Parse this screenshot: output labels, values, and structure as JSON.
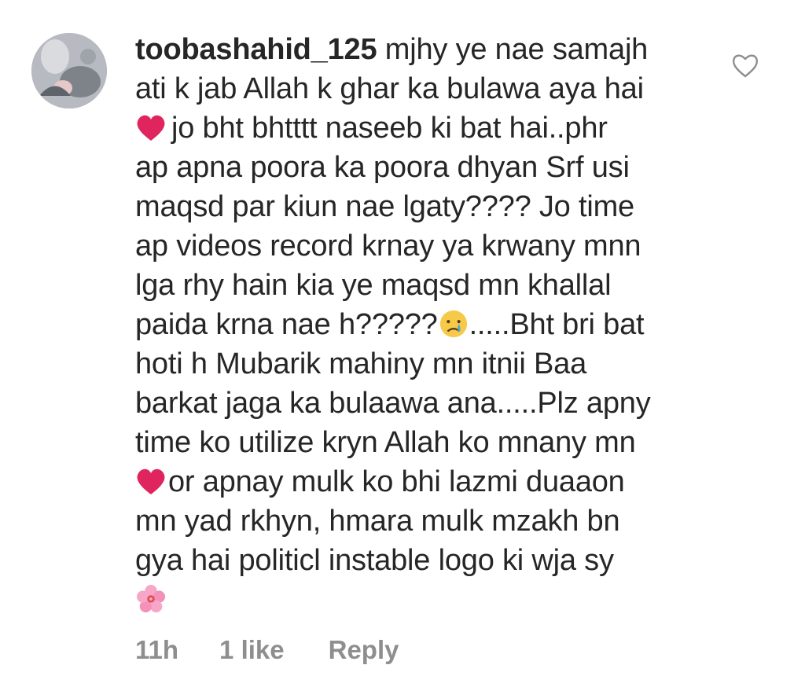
{
  "comment": {
    "username": "toobashahid_125",
    "lines": [
      "mjhy ye nae samajh",
      "ati k jab Allah k ghar ka bulawa aya hai",
      "jo bht bhtttt naseeb ki bat hai..phr",
      "ap apna poora ka poora dhyan Srf usi",
      "maqsd par kiun nae lgaty???? Jo time",
      "ap videos record krnay ya krwany mnn",
      "lga rhy hain kia ye maqsd mn khallal",
      "paida krna nae h?????",
      ".....Bht bri bat",
      "hoti h Mubarik mahiny mn itnii Baa",
      "barkat jaga ka bulaawa ana.....Plz apny",
      "time ko utilize kryn Allah ko mnany mn",
      "or apnay mulk ko bhi  lazmi duaaon",
      "mn yad rkhyn, hmara mulk mzakh bn",
      "gya hai politicl instable logo ki wja sy"
    ],
    "emojis": {
      "heart": "red-heart-emoji",
      "crying": "crying-face-emoji",
      "flower": "hibiscus-emoji"
    }
  },
  "meta": {
    "time": "11h",
    "likes": "1 like",
    "reply": "Reply"
  },
  "colors": {
    "text": "#262626",
    "secondary": "#8e8e8e",
    "heart_emoji": "#e0245e",
    "flower": "#f7a6c8"
  }
}
